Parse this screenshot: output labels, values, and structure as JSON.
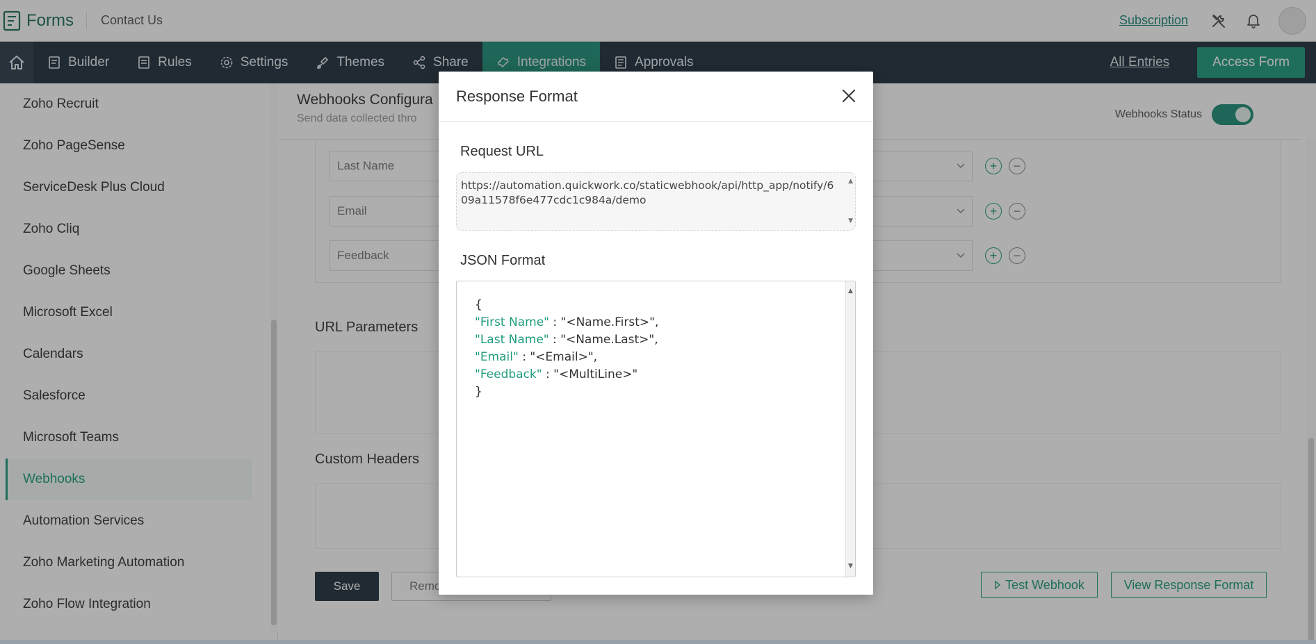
{
  "app": {
    "name": "Forms",
    "form_name": "Contact Us"
  },
  "header": {
    "subscription_label": "Subscription"
  },
  "nav": {
    "items": [
      {
        "label": "Builder",
        "icon": "builder-icon"
      },
      {
        "label": "Rules",
        "icon": "rules-icon"
      },
      {
        "label": "Settings",
        "icon": "gear-icon"
      },
      {
        "label": "Themes",
        "icon": "brush-icon"
      },
      {
        "label": "Share",
        "icon": "share-icon"
      },
      {
        "label": "Integrations",
        "icon": "puzzle-icon",
        "active": true
      },
      {
        "label": "Approvals",
        "icon": "approvals-icon"
      }
    ],
    "all_entries_label": "All Entries",
    "access_form_label": "Access Form"
  },
  "sidebar": {
    "items": [
      {
        "label": "Zoho Recruit"
      },
      {
        "label": "Zoho PageSense"
      },
      {
        "label": "ServiceDesk Plus Cloud"
      },
      {
        "label": "Zoho Cliq"
      },
      {
        "label": "Google Sheets"
      },
      {
        "label": "Microsoft Excel"
      },
      {
        "label": "Calendars"
      },
      {
        "label": "Salesforce"
      },
      {
        "label": "Microsoft Teams"
      },
      {
        "label": "Webhooks",
        "active": true
      },
      {
        "label": "Automation Services"
      },
      {
        "label": "Zoho Marketing Automation"
      },
      {
        "label": "Zoho Flow Integration"
      }
    ]
  },
  "main": {
    "title": "Webhooks Configura",
    "subtitle": "Send data collected thro",
    "status_label": "Webhooks Status",
    "status_on": true,
    "fields": [
      {
        "label": "Last Name"
      },
      {
        "label": "Email"
      },
      {
        "label": "Feedback"
      }
    ],
    "url_params_label": "URL Parameters",
    "custom_headers_label": "Custom Headers",
    "save_label": "Save",
    "remove_label": "Remo",
    "test_label": "Test Webhook",
    "view_response_label": "View Response Format"
  },
  "modal": {
    "title": "Response Format",
    "request_url_label": "Request URL",
    "request_url": "https://automation.quickwork.co/staticwebhook/api/http_app/notify/609a11578f6e477cdc1c984a/demo",
    "json_label": "JSON Format",
    "json_open": "{",
    "json_close": "}",
    "json_entries": [
      {
        "key": "\"First Name\"",
        "value": " : \"<Name.First>\","
      },
      {
        "key": "\"Last Name\"",
        "value": " : \"<Name.Last>\","
      },
      {
        "key": "\"Email\"",
        "value": " : \"<Email>\","
      },
      {
        "key": "\"Feedback\"",
        "value": " : \"<MultiLine>\""
      }
    ]
  },
  "colors": {
    "accent": "#1e9b7e",
    "nav_bg": "#21313d",
    "active_nav": "#1e8f77"
  }
}
